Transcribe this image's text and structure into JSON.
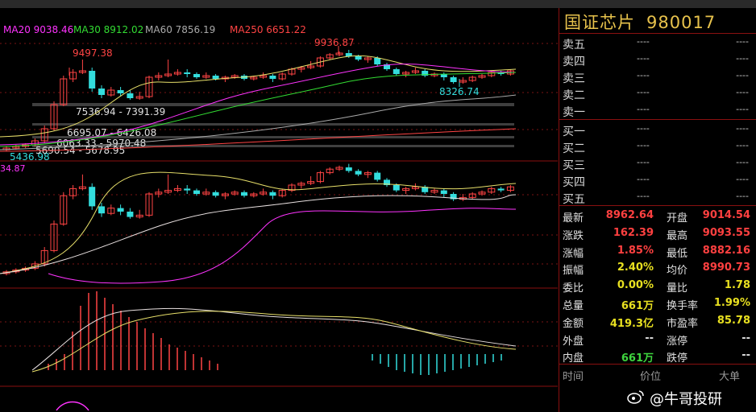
{
  "ma_legend": [
    {
      "label": "MA20 9038.46",
      "color": "#ff33ff"
    },
    {
      "label": "MA30 8912.02",
      "color": "#33dd33"
    },
    {
      "label": "MA60 7856.19",
      "color": "#aaaaaa"
    },
    {
      "label": "MA250 6651.22",
      "color": "#ff4444"
    }
  ],
  "chart_annotations": {
    "high_price": "9497.38",
    "peak_price": "9936.87",
    "low_price": "8326.74",
    "left_low": "5436.98",
    "cut_value": "34.87",
    "gap_1": "7536.94 - 7391.39",
    "gap_2": "6695.07 - 6426.08",
    "gap_3": "6063.33 - 5970.48",
    "gap_4": "5690.54 - 5678.95"
  },
  "instrument": {
    "name": "国证芯片",
    "code": "980017"
  },
  "order_book": {
    "asks": [
      {
        "label": "卖五",
        "price": "----",
        "vol": "----"
      },
      {
        "label": "卖四",
        "price": "----",
        "vol": "----"
      },
      {
        "label": "卖三",
        "price": "----",
        "vol": "----"
      },
      {
        "label": "卖二",
        "price": "----",
        "vol": "----"
      },
      {
        "label": "卖一",
        "price": "----",
        "vol": "----"
      }
    ],
    "bids": [
      {
        "label": "买一",
        "price": "----",
        "vol": "----"
      },
      {
        "label": "买二",
        "price": "----",
        "vol": "----"
      },
      {
        "label": "买三",
        "price": "----",
        "vol": "----"
      },
      {
        "label": "买四",
        "price": "----",
        "vol": "----"
      },
      {
        "label": "买五",
        "price": "----",
        "vol": "----"
      }
    ]
  },
  "quotes": [
    {
      "k1": "最新",
      "v1": "8962.64",
      "c1": "red",
      "k2": "开盘",
      "v2": "9014.54",
      "c2": "red"
    },
    {
      "k1": "涨跌",
      "v1": "162.39",
      "c1": "red",
      "k2": "最高",
      "v2": "9093.55",
      "c2": "red"
    },
    {
      "k1": "涨幅",
      "v1": "1.85%",
      "c1": "red",
      "k2": "最低",
      "v2": "8882.16",
      "c2": "red"
    },
    {
      "k1": "振幅",
      "v1": "2.40%",
      "c1": "yellow",
      "k2": "均价",
      "v2": "8990.73",
      "c2": "red"
    },
    {
      "k1": "委比",
      "v1": "0.00%",
      "c1": "yellow",
      "k2": "量比",
      "v2": "1.78",
      "c2": "yellow"
    },
    {
      "k1": "总量",
      "v1": "661万",
      "c1": "yellow",
      "k2": "换手率",
      "v2": "1.99%",
      "c2": "yellow"
    },
    {
      "k1": "金额",
      "v1": "419.3亿",
      "c1": "yellow",
      "k2": "市盈率",
      "v2": "85.78",
      "c2": "yellow"
    },
    {
      "k1": "外盘",
      "v1": "--",
      "c1": "white",
      "k2": "涨停",
      "v2": "--",
      "c2": "white"
    },
    {
      "k1": "内盘",
      "v1": "661万",
      "c1": "green",
      "k2": "跌停",
      "v2": "--",
      "c2": "white"
    }
  ],
  "tick_headers": {
    "time": "时间",
    "price": "价位",
    "volume": "大单"
  },
  "watermark": "@牛哥投研"
}
